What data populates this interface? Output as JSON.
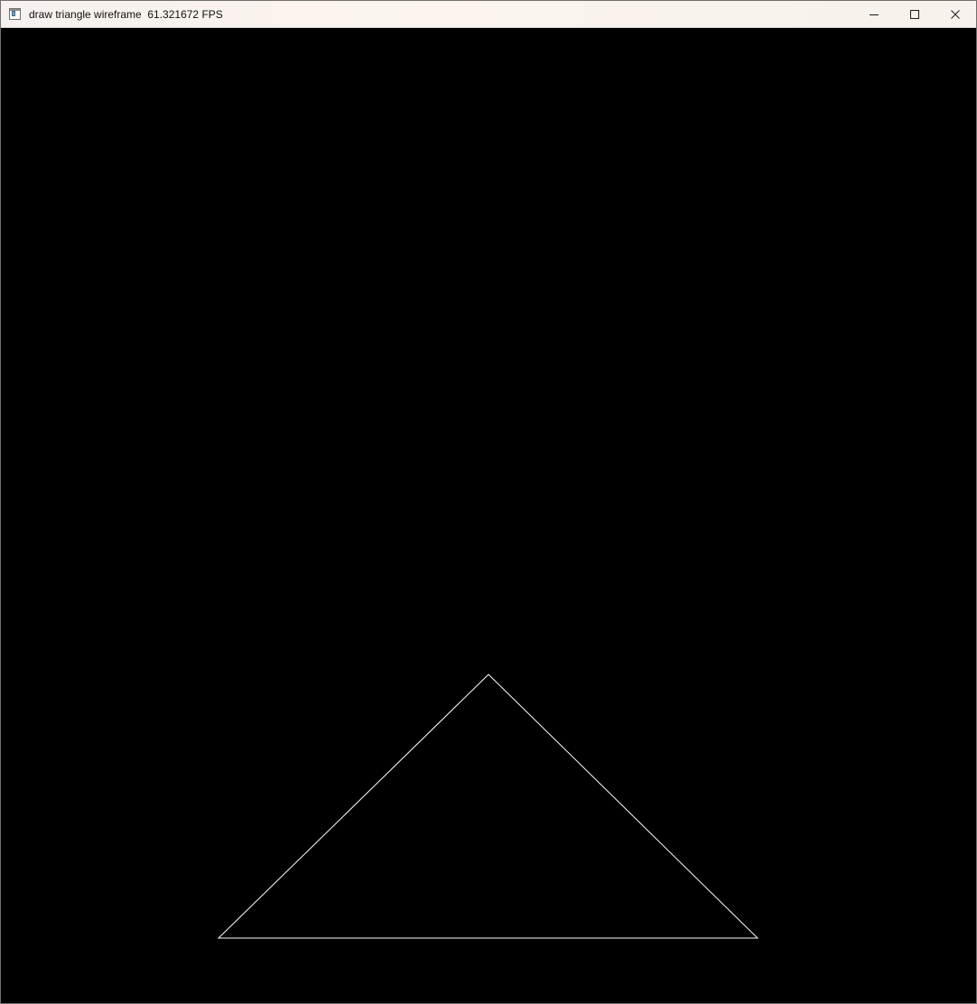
{
  "window": {
    "title": "draw triangle wireframe  61.321672 FPS",
    "icon": "application-window-icon",
    "controls": {
      "minimize_icon": "minimize-icon",
      "maximize_icon": "maximize-icon",
      "close_icon": "close-icon"
    }
  },
  "canvas": {
    "background_color": "#000000",
    "shape": "triangle wireframe",
    "stroke_color": "#ffffff"
  }
}
